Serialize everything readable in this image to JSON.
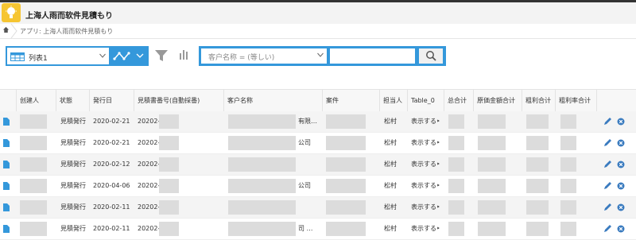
{
  "app": {
    "title": "上海人雨而软件見積もり",
    "breadcrumb": "アプリ: 上海人雨而软件見積もり"
  },
  "toolbar": {
    "view_label": "列表1",
    "field_select": "客户名称 = (等しい)",
    "search_value": ""
  },
  "columns": [
    "创建人",
    "状態",
    "発行日",
    "見積書番号(自動採番)",
    "客户名称",
    "案件",
    "担当人",
    "Table_0",
    "总合计",
    "原価金額合计",
    "粗利合计",
    "粗利率合计"
  ],
  "rows": [
    {
      "status": "見積発行",
      "date": "2020-02-21",
      "number": "20202-",
      "customer_suffix": "有限…",
      "assignee": "松村",
      "table0": "表示する‣"
    },
    {
      "status": "見積発行",
      "date": "2020-02-21",
      "number": "20202-",
      "customer_suffix": "公司",
      "assignee": "松村",
      "table0": "表示する‣"
    },
    {
      "status": "見積発行",
      "date": "2020-02-12",
      "number": "20202-",
      "customer_suffix": "",
      "assignee": "松村",
      "table0": "表示する‣"
    },
    {
      "status": "見積発行",
      "date": "2020-04-06",
      "number": "20202-",
      "customer_suffix": "公司",
      "assignee": "松村",
      "table0": "表示する‣"
    },
    {
      "status": "見積発行",
      "date": "2020-02-11",
      "number": "20202-",
      "customer_suffix": "",
      "assignee": "松村",
      "table0": "表示する‣"
    },
    {
      "status": "見積発行",
      "date": "2020-02-11",
      "number": "20202-",
      "customer_suffix": "司 …",
      "assignee": "松村",
      "table0": "表示する‣"
    }
  ],
  "icons": [
    "app-bulb-icon",
    "home-icon",
    "table-view-icon",
    "graph-icon",
    "filter-icon",
    "bar-chart-icon",
    "search-icon",
    "document-icon",
    "edit-icon",
    "delete-icon"
  ]
}
